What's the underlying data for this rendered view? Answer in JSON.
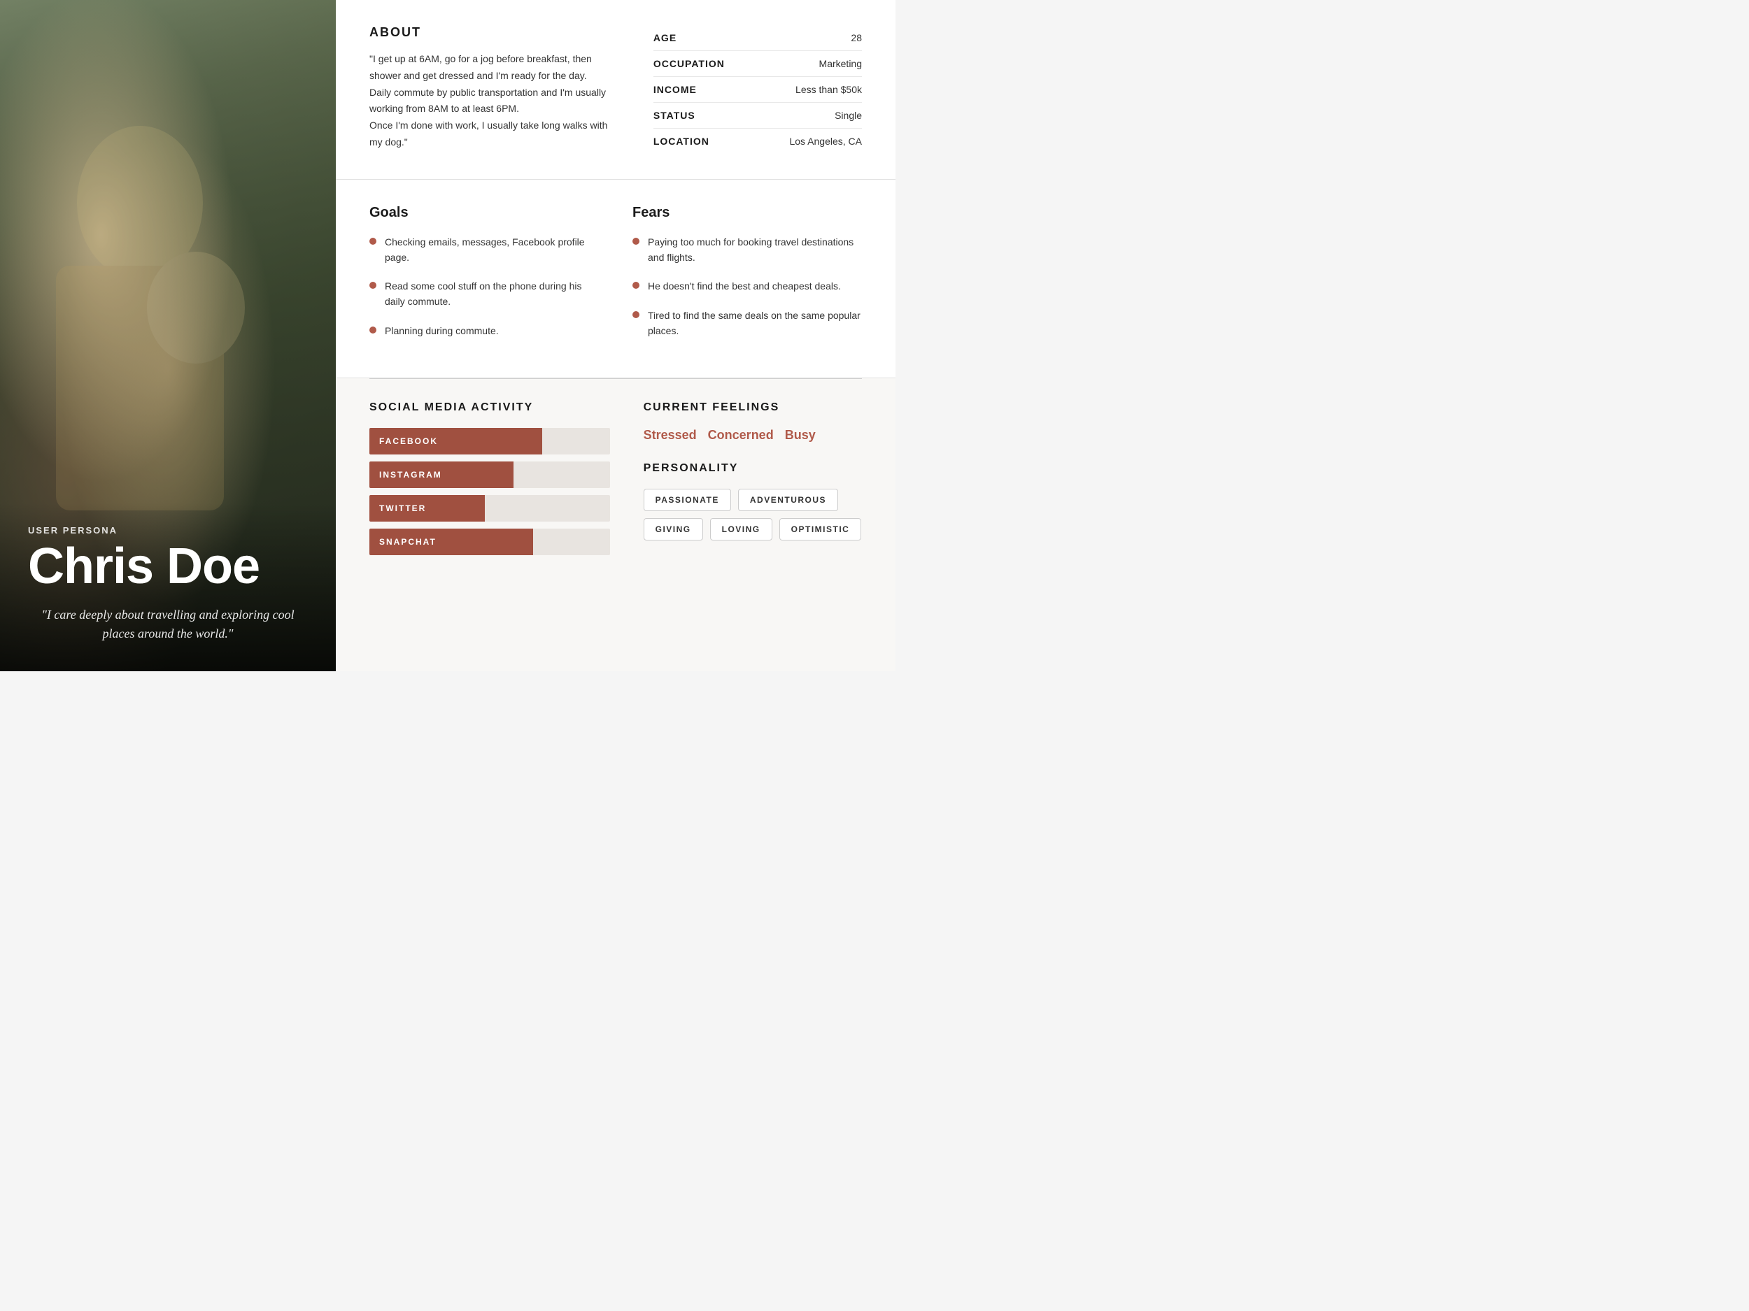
{
  "left": {
    "persona_label": "USER PERSONA",
    "name": "Chris Doe",
    "quote": "\"I care deeply about travelling and exploring cool places around the world.\""
  },
  "about": {
    "title": "ABOUT",
    "text": "\"I get up at 6AM, go for a jog before breakfast, then shower and get dressed and I'm ready for the day.\nDaily commute by public transportation and I'm usually working from 8AM to at least 6PM.\nOnce I'm done with work, I usually take long walks with my dog.\"",
    "stats": [
      {
        "label": "AGE",
        "value": "28"
      },
      {
        "label": "OCCUPATION",
        "value": "Marketing"
      },
      {
        "label": "INCOME",
        "value": "Less than $50k"
      },
      {
        "label": "STATUS",
        "value": "Single"
      },
      {
        "label": "LOCATION",
        "value": "Los Angeles, CA"
      }
    ]
  },
  "goals": {
    "title": "Goals",
    "items": [
      "Checking emails, messages, Facebook profile page.",
      "Read some cool stuff on the phone during his daily commute.",
      "Planning during commute."
    ]
  },
  "fears": {
    "title": "Fears",
    "items": [
      "Paying too much for booking travel destinations and flights.",
      "He doesn't find the best and cheapest deals.",
      "Tired to find the same deals on the same popular places."
    ]
  },
  "social_media": {
    "title": "SOCIAL MEDIA ACTIVITY",
    "bars": [
      {
        "label": "FACEBOOK",
        "fill_pct": 72
      },
      {
        "label": "INSTAGRAM",
        "fill_pct": 60
      },
      {
        "label": "TWITTER",
        "fill_pct": 48
      },
      {
        "label": "SNAPCHAT",
        "fill_pct": 68
      }
    ]
  },
  "feelings": {
    "title": "CURRENT FEELINGS",
    "tags": [
      "Stressed",
      "Concerned",
      "Busy"
    ]
  },
  "personality": {
    "title": "PERSONALITY",
    "chips": [
      "PASSIONATE",
      "ADVENTUROUS",
      "GIVING",
      "LOVING",
      "OPTIMISTIC"
    ]
  }
}
